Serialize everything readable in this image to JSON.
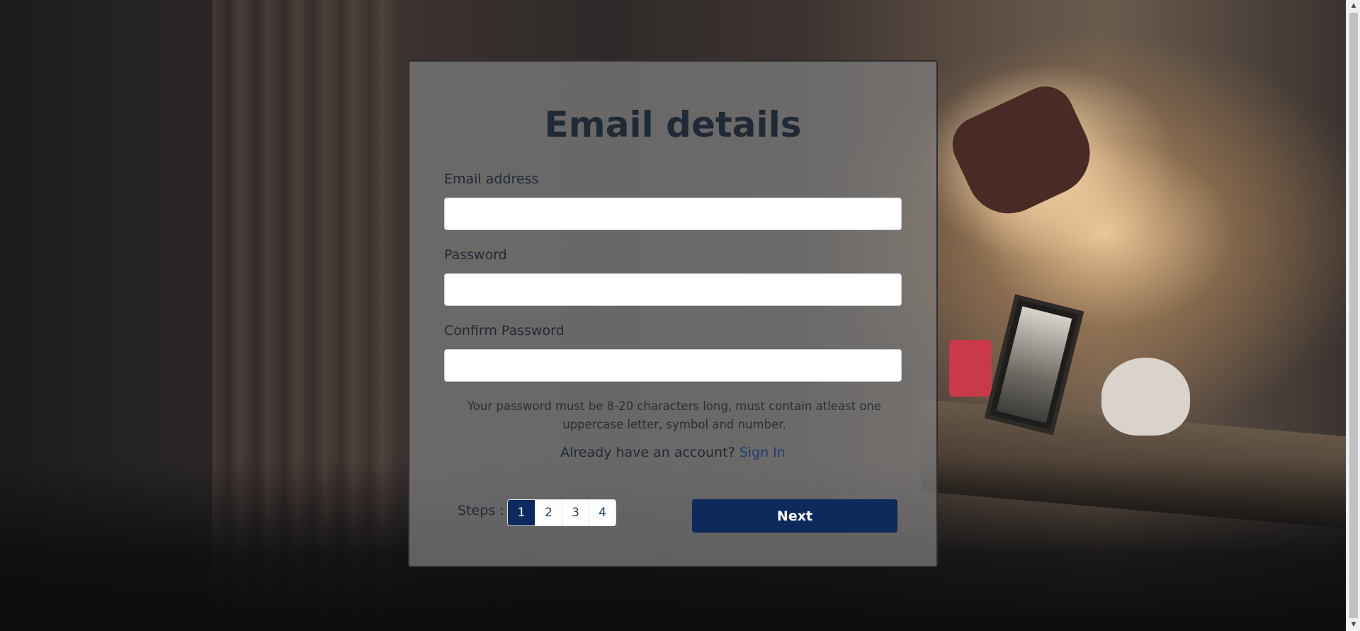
{
  "form": {
    "title": "Email details",
    "fields": [
      {
        "label": "Email address",
        "value": "",
        "placeholder": ""
      },
      {
        "label": "Password",
        "value": "",
        "placeholder": ""
      },
      {
        "label": "Confirm Password",
        "value": "",
        "placeholder": ""
      }
    ],
    "password_hint": "Your password must be 8-20 characters long, must contain atleast one uppercase letter, symbol and number.",
    "signin_prompt": "Already have an account?",
    "signin_link": "Sign In",
    "steps_label": "Steps :",
    "steps": [
      "1",
      "2",
      "3",
      "4"
    ],
    "active_step": "1",
    "next_label": "Next"
  },
  "scrollbar": {
    "up": "▲",
    "down": "▼"
  },
  "colors": {
    "primary": "#0d2a5c",
    "link": "#1c3f73",
    "card_overlay": "rgba(128,128,128,0.72)"
  }
}
